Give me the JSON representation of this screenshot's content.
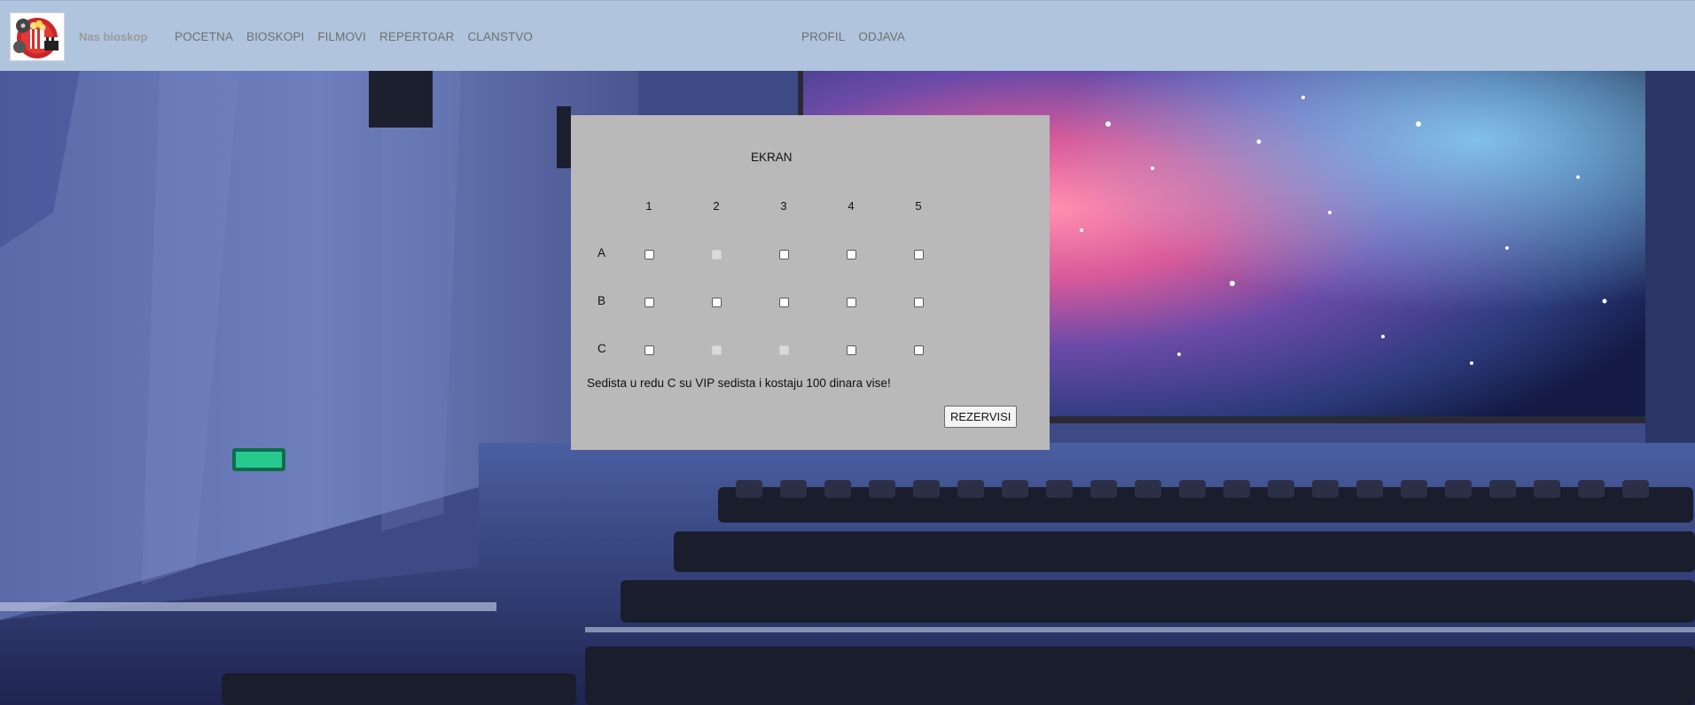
{
  "brand": {
    "name": "Nas bioskop",
    "logo_icon": "popcorn-film-logo-icon"
  },
  "nav": {
    "links": [
      "POCETNA",
      "BIOSKOPI",
      "FILMOVI",
      "REPERTOAR",
      "CLANSTVO"
    ],
    "right": [
      "PROFIL",
      "ODJAVA"
    ]
  },
  "seating": {
    "screen_label": "EKRAN",
    "columns": [
      "1",
      "2",
      "3",
      "4",
      "5"
    ],
    "rows": [
      {
        "label": "A",
        "seats": [
          "free",
          "taken",
          "free",
          "free",
          "free"
        ]
      },
      {
        "label": "B",
        "seats": [
          "free",
          "free",
          "free",
          "free",
          "free"
        ]
      },
      {
        "label": "C",
        "seats": [
          "free",
          "taken",
          "taken",
          "free",
          "free"
        ]
      }
    ],
    "note": "Sedista u redu C su VIP sedista i kostaju 100 dinara vise!",
    "reserve_label": "REZERVISI"
  },
  "colors": {
    "navbar": "#b0c4de",
    "panel": "#b9b9b9",
    "nav_text": "#6f6f6f"
  }
}
